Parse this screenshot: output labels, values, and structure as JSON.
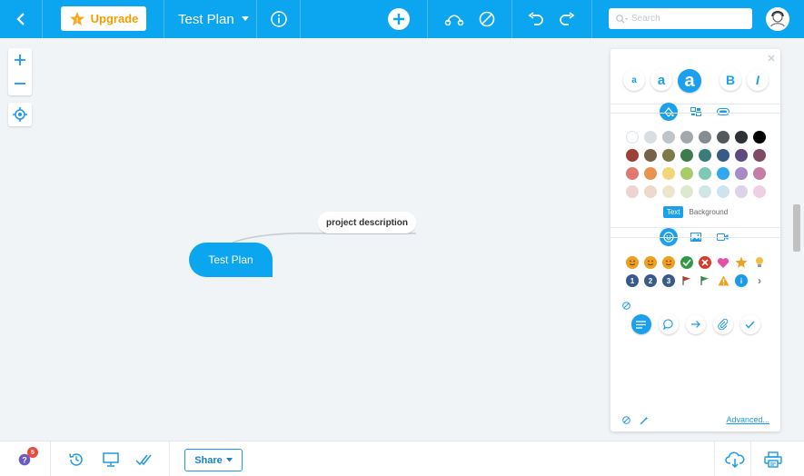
{
  "topbar": {
    "upgrade_label": "Upgrade",
    "map_title": "Test Plan",
    "search_placeholder": "Search"
  },
  "canvas": {
    "root_node": "Test Plan",
    "child_node": "project description"
  },
  "panel": {
    "font_sizes": [
      "a",
      "a",
      "a"
    ],
    "bold_label": "B",
    "italic_label": "I",
    "color_rows": [
      [
        "#ffffff",
        "#d9dee2",
        "#bfc4c8",
        "#a3a8ad",
        "#878c91",
        "#53585d",
        "#2e3236",
        "#000000"
      ],
      [
        "#9e3f34",
        "#76614a",
        "#7d7a4a",
        "#3f7a4a",
        "#3b7b7a",
        "#365b85",
        "#5e4a7e",
        "#7e4a66"
      ],
      [
        "#e07a70",
        "#e8944e",
        "#f2d67a",
        "#a9cb6a",
        "#7ec8b5",
        "#2fa8f0",
        "#a88ac6",
        "#c47ea5"
      ],
      [
        "#eed3d1",
        "#efd9cc",
        "#ece7cc",
        "#dce9cf",
        "#cfe8e5",
        "#cfe2f0",
        "#dcd2ea",
        "#eed0e2"
      ]
    ],
    "text_tab": "Text",
    "background_tab": "Background",
    "icon_rows": [
      [
        "#f0a020",
        "#f0a020",
        "#f0a020",
        "#2e9a45",
        "#d63b2f",
        "#e64fa8",
        "#f0a020",
        "#f0c040"
      ],
      [
        "#3a5a8a",
        "#3a5a8a",
        "#3a5a8a",
        "#c0392b",
        "#2e9a45",
        "#f0a020",
        "#1a9ae8",
        ""
      ]
    ],
    "number_icons": [
      "1",
      "2",
      "3"
    ],
    "advanced_label": "Advanced..."
  },
  "bottombar": {
    "notification_count": "5",
    "share_label": "Share"
  }
}
